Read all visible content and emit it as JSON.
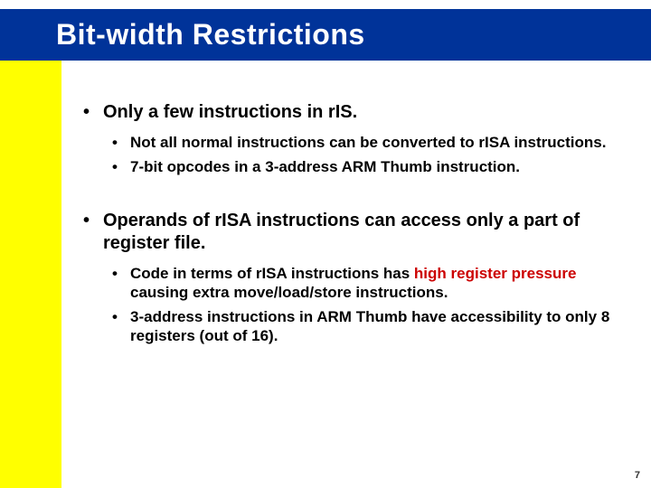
{
  "title": "Bit-width Restrictions",
  "bullets": {
    "b1": "Only a few instructions in rIS.",
    "b1_1": "Not all normal instructions can be converted to rISA instructions.",
    "b1_2": "7-bit opcodes in a 3-address ARM Thumb instruction.",
    "b2": "Operands of rISA instructions can access only a part of register file.",
    "b2_1_pre": "Code in terms of rISA instructions has ",
    "b2_1_hl": "high register pressure",
    "b2_1_post": " causing extra move/load/store instructions.",
    "b2_2": "3-address instructions in ARM Thumb have accessibility to only 8 registers (out of 16)."
  },
  "page_number": "7"
}
